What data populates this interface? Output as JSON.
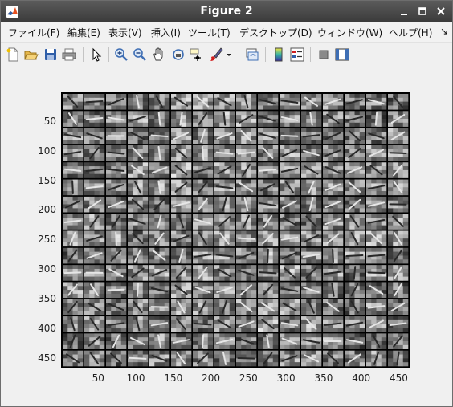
{
  "window": {
    "title": "Figure 2"
  },
  "menubar": {
    "items": [
      "ファイル(F)",
      "編集(E)",
      "表示(V)",
      "挿入(I)",
      "ツール(T)",
      "デスクトップ(D)",
      "ウィンドウ(W)",
      "ヘルプ(H)"
    ],
    "overflow_glyph": "↘"
  },
  "toolbar": {
    "icons": [
      "new-figure-icon",
      "open-file-icon",
      "save-icon",
      "print-icon",
      "pointer-icon",
      "zoom-in-icon",
      "zoom-out-icon",
      "pan-hand-icon",
      "rotate-3d-icon",
      "data-cursor-icon",
      "brush-icon",
      "dropdown-arrow-icon",
      "link-plot-icon",
      "colorbar-icon",
      "legend-icon",
      "hide-plot-tools-icon",
      "show-plot-tools-icon"
    ]
  },
  "plot": {
    "image": "grid of 16x16 grayscale filter patches (image display)",
    "grid_rows": 16,
    "grid_cols": 16,
    "x_ticks": [
      "50",
      "100",
      "150",
      "200",
      "250",
      "300",
      "350",
      "400",
      "450"
    ],
    "y_ticks": [
      "50",
      "100",
      "150",
      "200",
      "250",
      "300",
      "350",
      "400",
      "450"
    ],
    "x_tick_values": [
      50,
      100,
      150,
      200,
      250,
      300,
      350,
      400,
      450
    ],
    "y_tick_values": [
      50,
      100,
      150,
      200,
      250,
      300,
      350,
      400,
      450
    ],
    "axis_range": [
      0.5,
      464.5
    ]
  },
  "colors": {
    "titlebar": "#4a4a4a",
    "separator": "#000000"
  }
}
